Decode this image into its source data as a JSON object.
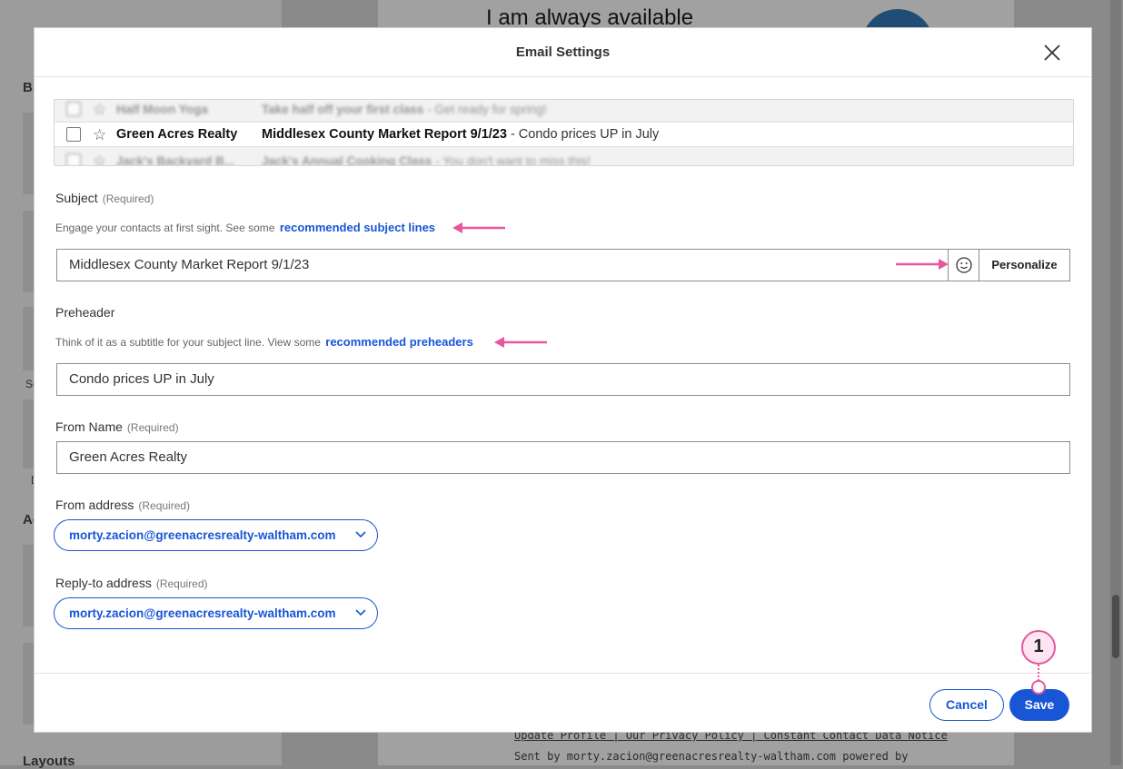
{
  "background": {
    "sidebar_labels": [
      "Bl",
      "Ac",
      "Layouts"
    ],
    "sidebar_small": [
      "So",
      "D"
    ],
    "canvas_heading": "I am always available",
    "footer_links": "Update Profile | Our Privacy Policy | Constant Contact Data Notice",
    "footer_sent": "Sent by morty.zacion@greenacresrealty-waltham.com powered by"
  },
  "modal": {
    "title": "Email Settings",
    "close_icon": "close-icon"
  },
  "inbox_preview": {
    "rows": [
      {
        "sender": "Half Moon Yoga",
        "subject": "Take half off your first class",
        "preheader": " - Get ready for spring!"
      },
      {
        "sender": "Green Acres Realty",
        "subject": "Middlesex County Market Report 9/1/23",
        "preheader": " - Condo prices UP in July"
      },
      {
        "sender": "Jack's Backyard B...",
        "subject": "Jack's Annual Cooking Class",
        "preheader": " - You don't want to miss this!"
      }
    ]
  },
  "form": {
    "subject": {
      "label": "Subject",
      "required": "(Required)",
      "helper": "Engage your contacts at first sight. See some",
      "helper_link": "recommended subject lines",
      "value": "Middlesex County Market Report 9/1/23",
      "personalize": "Personalize",
      "emoji_icon": "smiley-icon"
    },
    "preheader": {
      "label": "Preheader",
      "helper": "Think of it as a subtitle for your subject line. View some",
      "helper_link": "recommended preheaders",
      "value": "Condo prices UP in July"
    },
    "from_name": {
      "label": "From Name",
      "required": "(Required)",
      "value": "Green Acres Realty"
    },
    "from_address": {
      "label": "From address",
      "required": "(Required)",
      "value": "morty.zacion@greenacresrealty-waltham.com"
    },
    "reply_to": {
      "label": "Reply-to address",
      "required": "(Required)",
      "value": "morty.zacion@greenacresrealty-waltham.com"
    }
  },
  "footer": {
    "cancel": "Cancel",
    "save": "Save"
  },
  "annotation": {
    "callout_number": "1",
    "accent": "#e9559e"
  },
  "colors": {
    "brand_blue": "#1856d6",
    "overlay": "#8a8a8a"
  }
}
